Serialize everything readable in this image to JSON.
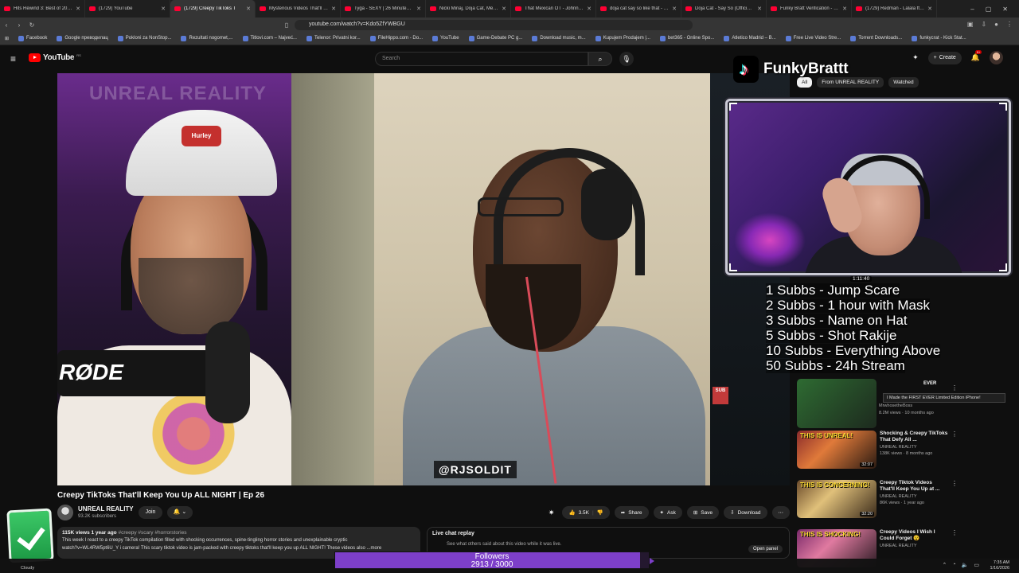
{
  "browser": {
    "tabs": [
      {
        "title": "Hits Rewind 3: Best of 2010's I"
      },
      {
        "title": "(1729) YouTube"
      },
      {
        "title": "(1729) Creepy TikToks T"
      },
      {
        "title": "Mysterious Videos That'll Mak"
      },
      {
        "title": "Tyga - SEXY | 26 Minutes Best"
      },
      {
        "title": "Nicki Minaj, Doja Cat, Megan"
      },
      {
        "title": "That Mexican OT - Johnny Dan"
      },
      {
        "title": "doja cat say so like that - You"
      },
      {
        "title": "Doja Cat - Say So (Official Vide"
      },
      {
        "title": "Funky Bratt Verification - Kittl"
      },
      {
        "title": "(1729) Redman - Lalala ft. Met"
      }
    ],
    "active_tab_index": 2,
    "url": "youtube.com/watch?v=Kdo5ZfYWBGU",
    "bookmarks": [
      "Facebook",
      "Google преводилац",
      "Pokloni za NonStop...",
      "Rezultati nogomet,...",
      "Titlovi.com – Najveć...",
      "Telenor: Privatni kor...",
      "FileHippo.com - Do...",
      "YouTube",
      "Game-Debate PC g...",
      "Download music, m...",
      "Kupujem Prodajem |...",
      "bet365 - Online Spo...",
      "Atletico Madrid – B...",
      "Free Live Video Stre...",
      "Torrent Downloads...",
      "funkycrat - Kick Stat..."
    ]
  },
  "youtube": {
    "logo_text": "YouTube",
    "region": "RS",
    "search_placeholder": "Search",
    "create_label": "Create",
    "notifications_badge": "9+"
  },
  "video": {
    "watermark": "UNREAL REALITY",
    "cap_logo": "Hurley",
    "mic_brand": "RØDE",
    "handle_overlay": "@RJSOLDIT",
    "corner_badge": "SUB",
    "title": "Creepy TikToks That'll Keep You Up ALL NIGHT | Ep 26",
    "channel": "UNREAL REALITY",
    "subscribers": "93.2K subscribers",
    "join_label": "Join",
    "likes": "3.5K",
    "share_label": "Share",
    "ask_label": "Ask",
    "save_label": "Save",
    "download_label": "Download",
    "description": {
      "views_time": "115K views  1 year ago",
      "tags": "#creepy #scary #horrorstories",
      "line1": "This week I react to a creepy TikTok compilation filled with shocking occurrences, spine-tingling horror stories and unexplainable cryptic",
      "line2": "watch?v=WL4RW5pt6U_Y  i camera! This scary tiktok video is jam-packed with creepy tiktoks that'll keep you up ALL NIGHT! These videos also ...more"
    },
    "live_chat": {
      "title": "Live chat replay",
      "subtitle": "See what others said about this video while it was live.",
      "open_label": "Open panel"
    }
  },
  "sidebar": {
    "chips": [
      "All",
      "From UNREAL REALITY",
      "Watched"
    ],
    "recommendations": [
      {
        "thumb_caption": "THIS IS UNREAL!",
        "duration": "32:07",
        "title": "Shocking & Creepy TikToks That Defy All ...",
        "channel": "UNREAL REALITY",
        "stats": "138K views · 8 months ago"
      },
      {
        "thumb_caption": "THIS IS CONCERNING!",
        "duration": "32:20",
        "title": "Creepy Tiktok Videos That'll Keep You Up at ...",
        "channel": "UNREAL REALITY",
        "stats": "86K views · 1 year ago"
      },
      {
        "thumb_caption": "THIS IS SHOCKING!",
        "duration": "",
        "title": "Creepy Videos I Wish I Could Forget 😵",
        "channel": "UNREAL REALITY",
        "stats": ""
      }
    ],
    "ghost_item": {
      "title_fragment": "EVER",
      "tooltip": "I Made the FIRST EVER Limited Edition iPhone!",
      "channel": "MrwhosetheBoss",
      "stats": "8.2M views · 10 months ago"
    }
  },
  "stream_overlay": {
    "tiktok_name": "FunkyBrattt",
    "timer": "1:11:40",
    "goals": [
      "1 Subbs - Jump Scare",
      "2 Subbs - 1 hour with Mask",
      "3 Subbs - Name on Hat",
      "5 Subbs - Shot Rakije",
      "10 Subbs - Everything Above",
      "50 Subbs - 24h Stream"
    ],
    "followers": {
      "label": "Followers",
      "current": 2913,
      "goal": 3000,
      "display": "2913 / 3000"
    }
  },
  "taskbar": {
    "weather": "Cloudy",
    "time": "7:35 AM",
    "date": "1/16/2026"
  }
}
